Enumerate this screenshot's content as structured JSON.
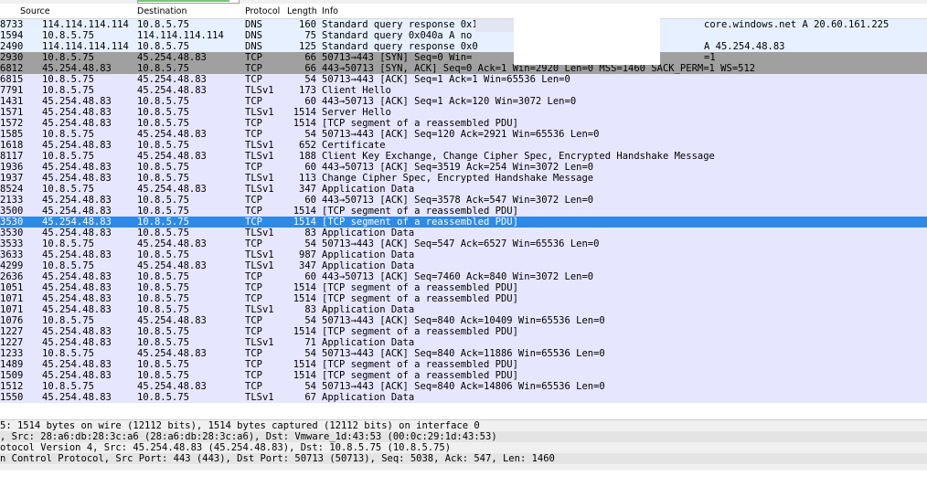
{
  "header": {
    "source": "Source",
    "destination": "Destination",
    "protocol": "Protocol",
    "length": "Length",
    "info": "Info"
  },
  "packets": [
    {
      "no": "8733",
      "src": "114.114.114.114",
      "dst": "10.8.5.75",
      "proto": "DNS",
      "len": "160",
      "info": "Standard query response 0x1",
      "info_right": "core.windows.net A 20.60.161.225",
      "kind": "dns"
    },
    {
      "no": "1594",
      "src": "10.8.5.75",
      "dst": "114.114.114.114",
      "proto": "DNS",
      "len": "75",
      "info": "Standard query 0x040a  A no",
      "info_right": "",
      "kind": "dns"
    },
    {
      "no": "2490",
      "src": "114.114.114.114",
      "dst": "10.8.5.75",
      "proto": "DNS",
      "len": "125",
      "info": "Standard query response 0x0",
      "info_right": "A 45.254.48.83",
      "kind": "dns"
    },
    {
      "no": "2930",
      "src": "10.8.5.75",
      "dst": "45.254.48.83",
      "proto": "TCP",
      "len": "66",
      "info": "50713→443 [SYN] Seq=0 Win=",
      "info_right": "=1",
      "kind": "syn"
    },
    {
      "no": "6812",
      "src": "45.254.48.83",
      "dst": "10.8.5.75",
      "proto": "TCP",
      "len": "66",
      "info": "443→50713 [SYN, ACK] Seq=0 Ack=1 Win=2920 Len=0 MSS=1460 SACK_PERM=1 WS=512",
      "info_right": "",
      "kind": "syn"
    },
    {
      "no": "6815",
      "src": "10.8.5.75",
      "dst": "45.254.48.83",
      "proto": "TCP",
      "len": "54",
      "info": "50713→443 [ACK] Seq=1 Ack=1 Win=65536 Len=0",
      "info_right": "",
      "kind": "tcp"
    },
    {
      "no": "7791",
      "src": "10.8.5.75",
      "dst": "45.254.48.83",
      "proto": "TLSv1",
      "len": "173",
      "info": "Client Hello",
      "info_right": "",
      "kind": "tcp"
    },
    {
      "no": "1431",
      "src": "45.254.48.83",
      "dst": "10.8.5.75",
      "proto": "TCP",
      "len": "60",
      "info": "443→50713 [ACK] Seq=1 Ack=120 Win=3072 Len=0",
      "info_right": "",
      "kind": "tcp"
    },
    {
      "no": "1571",
      "src": "45.254.48.83",
      "dst": "10.8.5.75",
      "proto": "TLSv1",
      "len": "1514",
      "info": "Server Hello",
      "info_right": "",
      "kind": "tcp"
    },
    {
      "no": "1572",
      "src": "45.254.48.83",
      "dst": "10.8.5.75",
      "proto": "TCP",
      "len": "1514",
      "info": "[TCP segment of a reassembled PDU]",
      "info_right": "",
      "kind": "tcp"
    },
    {
      "no": "1585",
      "src": "10.8.5.75",
      "dst": "45.254.48.83",
      "proto": "TCP",
      "len": "54",
      "info": "50713→443 [ACK] Seq=120 Ack=2921 Win=65536 Len=0",
      "info_right": "",
      "kind": "tcp"
    },
    {
      "no": "1618",
      "src": "45.254.48.83",
      "dst": "10.8.5.75",
      "proto": "TLSv1",
      "len": "652",
      "info": "Certificate",
      "info_right": "",
      "kind": "tcp"
    },
    {
      "no": "8117",
      "src": "10.8.5.75",
      "dst": "45.254.48.83",
      "proto": "TLSv1",
      "len": "188",
      "info": "Client Key Exchange, Change Cipher Spec, Encrypted Handshake Message",
      "info_right": "",
      "kind": "tcp"
    },
    {
      "no": "1936",
      "src": "45.254.48.83",
      "dst": "10.8.5.75",
      "proto": "TCP",
      "len": "60",
      "info": "443→50713 [ACK] Seq=3519 Ack=254 Win=3072 Len=0",
      "info_right": "",
      "kind": "tcp"
    },
    {
      "no": "1937",
      "src": "45.254.48.83",
      "dst": "10.8.5.75",
      "proto": "TLSv1",
      "len": "113",
      "info": "Change Cipher Spec, Encrypted Handshake Message",
      "info_right": "",
      "kind": "tcp"
    },
    {
      "no": "8524",
      "src": "10.8.5.75",
      "dst": "45.254.48.83",
      "proto": "TLSv1",
      "len": "347",
      "info": "Application Data",
      "info_right": "",
      "kind": "tcp"
    },
    {
      "no": "2133",
      "src": "45.254.48.83",
      "dst": "10.8.5.75",
      "proto": "TCP",
      "len": "60",
      "info": "443→50713 [ACK] Seq=3578 Ack=547 Win=3072 Len=0",
      "info_right": "",
      "kind": "tcp"
    },
    {
      "no": "3500",
      "src": "45.254.48.83",
      "dst": "10.8.5.75",
      "proto": "TCP",
      "len": "1514",
      "info": "[TCP segment of a reassembled PDU]",
      "info_right": "",
      "kind": "tcp"
    },
    {
      "no": "3530",
      "src": "45.254.48.83",
      "dst": "10.8.5.75",
      "proto": "TCP",
      "len": "1514",
      "info": "[TCP segment of a reassembled PDU]",
      "info_right": "",
      "kind": "sel"
    },
    {
      "no": "3530",
      "src": "45.254.48.83",
      "dst": "10.8.5.75",
      "proto": "TLSv1",
      "len": "83",
      "info": "Application Data",
      "info_right": "",
      "kind": "tcp"
    },
    {
      "no": "3533",
      "src": "10.8.5.75",
      "dst": "45.254.48.83",
      "proto": "TCP",
      "len": "54",
      "info": "50713→443 [ACK] Seq=547 Ack=6527 Win=65536 Len=0",
      "info_right": "",
      "kind": "tcp"
    },
    {
      "no": "3633",
      "src": "45.254.48.83",
      "dst": "10.8.5.75",
      "proto": "TLSv1",
      "len": "987",
      "info": "Application Data",
      "info_right": "",
      "kind": "tcp"
    },
    {
      "no": "4299",
      "src": "10.8.5.75",
      "dst": "45.254.48.83",
      "proto": "TLSv1",
      "len": "347",
      "info": "Application Data",
      "info_right": "",
      "kind": "tcp"
    },
    {
      "no": "2636",
      "src": "45.254.48.83",
      "dst": "10.8.5.75",
      "proto": "TCP",
      "len": "60",
      "info": "443→50713 [ACK] Seq=7460 Ack=840 Win=3072 Len=0",
      "info_right": "",
      "kind": "tcp"
    },
    {
      "no": "1051",
      "src": "45.254.48.83",
      "dst": "10.8.5.75",
      "proto": "TCP",
      "len": "1514",
      "info": "[TCP segment of a reassembled PDU]",
      "info_right": "",
      "kind": "tcp"
    },
    {
      "no": "1071",
      "src": "45.254.48.83",
      "dst": "10.8.5.75",
      "proto": "TCP",
      "len": "1514",
      "info": "[TCP segment of a reassembled PDU]",
      "info_right": "",
      "kind": "tcp"
    },
    {
      "no": "1071",
      "src": "45.254.48.83",
      "dst": "10.8.5.75",
      "proto": "TLSv1",
      "len": "83",
      "info": "Application Data",
      "info_right": "",
      "kind": "tcp"
    },
    {
      "no": "1076",
      "src": "10.8.5.75",
      "dst": "45.254.48.83",
      "proto": "TCP",
      "len": "54",
      "info": "50713→443 [ACK] Seq=840 Ack=10409 Win=65536 Len=0",
      "info_right": "",
      "kind": "tcp"
    },
    {
      "no": "1227",
      "src": "45.254.48.83",
      "dst": "10.8.5.75",
      "proto": "TCP",
      "len": "1514",
      "info": "[TCP segment of a reassembled PDU]",
      "info_right": "",
      "kind": "tcp"
    },
    {
      "no": "1227",
      "src": "45.254.48.83",
      "dst": "10.8.5.75",
      "proto": "TLSv1",
      "len": "71",
      "info": "Application Data",
      "info_right": "",
      "kind": "tcp"
    },
    {
      "no": "1233",
      "src": "10.8.5.75",
      "dst": "45.254.48.83",
      "proto": "TCP",
      "len": "54",
      "info": "50713→443 [ACK] Seq=840 Ack=11886 Win=65536 Len=0",
      "info_right": "",
      "kind": "tcp"
    },
    {
      "no": "1489",
      "src": "45.254.48.83",
      "dst": "10.8.5.75",
      "proto": "TCP",
      "len": "1514",
      "info": "[TCP segment of a reassembled PDU]",
      "info_right": "",
      "kind": "tcp"
    },
    {
      "no": "1509",
      "src": "45.254.48.83",
      "dst": "10.8.5.75",
      "proto": "TCP",
      "len": "1514",
      "info": "[TCP segment of a reassembled PDU]",
      "info_right": "",
      "kind": "tcp"
    },
    {
      "no": "1512",
      "src": "10.8.5.75",
      "dst": "45.254.48.83",
      "proto": "TCP",
      "len": "54",
      "info": "50713→443 [ACK] Seq=840 Ack=14806 Win=65536 Len=0",
      "info_right": "",
      "kind": "tcp"
    },
    {
      "no": "1550",
      "src": "45.254.48.83",
      "dst": "10.8.5.75",
      "proto": "TLSv1",
      "len": "67",
      "info": "Application Data",
      "info_right": "",
      "kind": "tcp"
    }
  ],
  "details": [
    "5: 1514 bytes on wire (12112 bits), 1514 bytes captured (12112 bits) on interface 0",
    ", Src: 28:a6:db:28:3c:a6 (28:a6:db:28:3c:a6), Dst: Vmware_1d:43:53 (00:0c:29:1d:43:53)",
    "otocol Version 4, Src: 45.254.48.83 (45.254.48.83), Dst: 10.8.5.75 (10.8.5.75)",
    "n Control Protocol, Src Port: 443 (443), Dst Port: 50713 (50713), Seq: 5038, Ack: 547, Len: 1460"
  ],
  "colors": {
    "selected": "#2c8ae8",
    "syn_row": "#a0a0a0",
    "tcp_row": "#e7e6ff",
    "dns_row": "#e6f0ff"
  }
}
